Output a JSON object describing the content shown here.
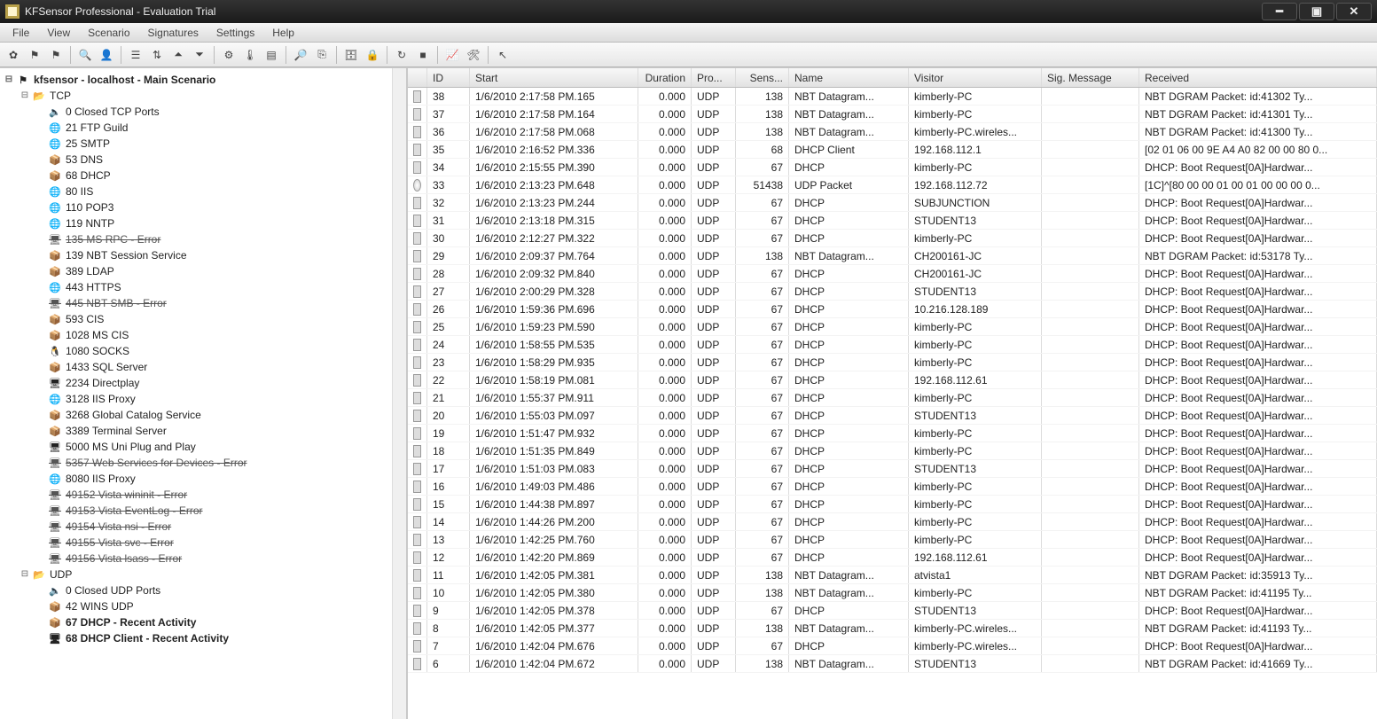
{
  "window": {
    "title": "KFSensor Professional - Evaluation Trial"
  },
  "menu": [
    "File",
    "View",
    "Scenario",
    "Signatures",
    "Settings",
    "Help"
  ],
  "tree_root": "kfsensor - localhost - Main Scenario",
  "tcp_label": "TCP",
  "udp_label": "UDP",
  "tcp_items": [
    {
      "port": "0",
      "name": "Closed TCP Ports",
      "icon": "speaker"
    },
    {
      "port": "21",
      "name": "FTP Guild",
      "icon": "globe"
    },
    {
      "port": "25",
      "name": "SMTP",
      "icon": "globe"
    },
    {
      "port": "53",
      "name": "DNS",
      "icon": "box"
    },
    {
      "port": "68",
      "name": "DHCP",
      "icon": "box"
    },
    {
      "port": "80",
      "name": "IIS",
      "icon": "globe"
    },
    {
      "port": "110",
      "name": "POP3",
      "icon": "globe"
    },
    {
      "port": "119",
      "name": "NNTP",
      "icon": "globe"
    },
    {
      "port": "135",
      "name": "MS RPC  - Error",
      "icon": "err",
      "strike": true
    },
    {
      "port": "139",
      "name": "NBT Session Service",
      "icon": "box"
    },
    {
      "port": "389",
      "name": "LDAP",
      "icon": "box"
    },
    {
      "port": "443",
      "name": "HTTPS",
      "icon": "globe"
    },
    {
      "port": "445",
      "name": "NBT SMB  - Error",
      "icon": "err",
      "strike": true
    },
    {
      "port": "593",
      "name": "CIS",
      "icon": "box"
    },
    {
      "port": "1028",
      "name": "MS CIS",
      "icon": "box"
    },
    {
      "port": "1080",
      "name": "SOCKS",
      "icon": "penguin"
    },
    {
      "port": "1433",
      "name": "SQL Server",
      "icon": "box"
    },
    {
      "port": "2234",
      "name": "Directplay",
      "icon": "pc"
    },
    {
      "port": "3128",
      "name": "IIS Proxy",
      "icon": "globe"
    },
    {
      "port": "3268",
      "name": "Global Catalog Service",
      "icon": "box"
    },
    {
      "port": "3389",
      "name": "Terminal Server",
      "icon": "box"
    },
    {
      "port": "5000",
      "name": "MS Uni Plug and Play",
      "icon": "pc"
    },
    {
      "port": "5357",
      "name": "Web Services for Devices  - Error",
      "icon": "err",
      "strike": true
    },
    {
      "port": "8080",
      "name": "IIS Proxy",
      "icon": "globe"
    },
    {
      "port": "49152",
      "name": "Vista wininit  - Error",
      "icon": "err",
      "strike": true
    },
    {
      "port": "49153",
      "name": "Vista EventLog  - Error",
      "icon": "err",
      "strike": true
    },
    {
      "port": "49154",
      "name": "Vista nsi  - Error",
      "icon": "err",
      "strike": true
    },
    {
      "port": "49155",
      "name": "Vista svc  - Error",
      "icon": "err",
      "strike": true
    },
    {
      "port": "49156",
      "name": "Vista lsass  - Error",
      "icon": "err",
      "strike": true
    }
  ],
  "udp_items": [
    {
      "port": "0",
      "name": "Closed UDP Ports",
      "icon": "speaker"
    },
    {
      "port": "42",
      "name": "WINS UDP",
      "icon": "box"
    },
    {
      "port": "67",
      "name": "DHCP  - Recent Activity",
      "icon": "box",
      "bold": true
    },
    {
      "port": "68",
      "name": "DHCP Client  - Recent Activity",
      "icon": "pc",
      "bold": true
    }
  ],
  "columns": {
    "id": "ID",
    "start": "Start",
    "duration": "Duration",
    "pro": "Pro...",
    "sens": "Sens...",
    "name": "Name",
    "visitor": "Visitor",
    "sig": "Sig. Message",
    "received": "Received"
  },
  "events": [
    {
      "id": "38",
      "start": "1/6/2010 2:17:58 PM.165",
      "dur": "0.000",
      "pro": "UDP",
      "sens": "138",
      "name": "NBT Datagram...",
      "vis": "kimberly-PC",
      "recv": "NBT DGRAM Packet: id:41302  Ty...",
      "icon": "pc"
    },
    {
      "id": "37",
      "start": "1/6/2010 2:17:58 PM.164",
      "dur": "0.000",
      "pro": "UDP",
      "sens": "138",
      "name": "NBT Datagram...",
      "vis": "kimberly-PC",
      "recv": "NBT DGRAM Packet: id:41301  Ty...",
      "icon": "pc"
    },
    {
      "id": "36",
      "start": "1/6/2010 2:17:58 PM.068",
      "dur": "0.000",
      "pro": "UDP",
      "sens": "138",
      "name": "NBT Datagram...",
      "vis": "kimberly-PC.wireles...",
      "recv": "NBT DGRAM Packet: id:41300  Ty...",
      "icon": "pc"
    },
    {
      "id": "35",
      "start": "1/6/2010 2:16:52 PM.336",
      "dur": "0.000",
      "pro": "UDP",
      "sens": "68",
      "name": "DHCP Client",
      "vis": "192.168.112.1",
      "recv": "[02 01 06 00 9E A4 A0 82 00 00 80 0...",
      "icon": "pc"
    },
    {
      "id": "34",
      "start": "1/6/2010 2:15:55 PM.390",
      "dur": "0.000",
      "pro": "UDP",
      "sens": "67",
      "name": "DHCP",
      "vis": "kimberly-PC",
      "recv": "DHCP: Boot Request[0A]Hardwar...",
      "icon": "box"
    },
    {
      "id": "33",
      "start": "1/6/2010 2:13:23 PM.648",
      "dur": "0.000",
      "pro": "UDP",
      "sens": "51438",
      "name": "UDP Packet",
      "vis": "192.168.112.72",
      "recv": "[1C]^[80 00 00 01 00 01 00 00 00 0...",
      "icon": "clock"
    },
    {
      "id": "32",
      "start": "1/6/2010 2:13:23 PM.244",
      "dur": "0.000",
      "pro": "UDP",
      "sens": "67",
      "name": "DHCP",
      "vis": "SUBJUNCTION",
      "recv": "DHCP: Boot Request[0A]Hardwar...",
      "icon": "box"
    },
    {
      "id": "31",
      "start": "1/6/2010 2:13:18 PM.315",
      "dur": "0.000",
      "pro": "UDP",
      "sens": "67",
      "name": "DHCP",
      "vis": "STUDENT13",
      "recv": "DHCP: Boot Request[0A]Hardwar...",
      "icon": "box"
    },
    {
      "id": "30",
      "start": "1/6/2010 2:12:27 PM.322",
      "dur": "0.000",
      "pro": "UDP",
      "sens": "67",
      "name": "DHCP",
      "vis": "kimberly-PC",
      "recv": "DHCP: Boot Request[0A]Hardwar...",
      "icon": "box"
    },
    {
      "id": "29",
      "start": "1/6/2010 2:09:37 PM.764",
      "dur": "0.000",
      "pro": "UDP",
      "sens": "138",
      "name": "NBT Datagram...",
      "vis": "CH200161-JC",
      "recv": "NBT DGRAM Packet: id:53178  Ty...",
      "icon": "pc"
    },
    {
      "id": "28",
      "start": "1/6/2010 2:09:32 PM.840",
      "dur": "0.000",
      "pro": "UDP",
      "sens": "67",
      "name": "DHCP",
      "vis": "CH200161-JC",
      "recv": "DHCP: Boot Request[0A]Hardwar...",
      "icon": "box"
    },
    {
      "id": "27",
      "start": "1/6/2010 2:00:29 PM.328",
      "dur": "0.000",
      "pro": "UDP",
      "sens": "67",
      "name": "DHCP",
      "vis": "STUDENT13",
      "recv": "DHCP: Boot Request[0A]Hardwar...",
      "icon": "box"
    },
    {
      "id": "26",
      "start": "1/6/2010 1:59:36 PM.696",
      "dur": "0.000",
      "pro": "UDP",
      "sens": "67",
      "name": "DHCP",
      "vis": "10.216.128.189",
      "recv": "DHCP: Boot Request[0A]Hardwar...",
      "icon": "box"
    },
    {
      "id": "25",
      "start": "1/6/2010 1:59:23 PM.590",
      "dur": "0.000",
      "pro": "UDP",
      "sens": "67",
      "name": "DHCP",
      "vis": "kimberly-PC",
      "recv": "DHCP: Boot Request[0A]Hardwar...",
      "icon": "box"
    },
    {
      "id": "24",
      "start": "1/6/2010 1:58:55 PM.535",
      "dur": "0.000",
      "pro": "UDP",
      "sens": "67",
      "name": "DHCP",
      "vis": "kimberly-PC",
      "recv": "DHCP: Boot Request[0A]Hardwar...",
      "icon": "box"
    },
    {
      "id": "23",
      "start": "1/6/2010 1:58:29 PM.935",
      "dur": "0.000",
      "pro": "UDP",
      "sens": "67",
      "name": "DHCP",
      "vis": "kimberly-PC",
      "recv": "DHCP: Boot Request[0A]Hardwar...",
      "icon": "box"
    },
    {
      "id": "22",
      "start": "1/6/2010 1:58:19 PM.081",
      "dur": "0.000",
      "pro": "UDP",
      "sens": "67",
      "name": "DHCP",
      "vis": "192.168.112.61",
      "recv": "DHCP: Boot Request[0A]Hardwar...",
      "icon": "box"
    },
    {
      "id": "21",
      "start": "1/6/2010 1:55:37 PM.911",
      "dur": "0.000",
      "pro": "UDP",
      "sens": "67",
      "name": "DHCP",
      "vis": "kimberly-PC",
      "recv": "DHCP: Boot Request[0A]Hardwar...",
      "icon": "box"
    },
    {
      "id": "20",
      "start": "1/6/2010 1:55:03 PM.097",
      "dur": "0.000",
      "pro": "UDP",
      "sens": "67",
      "name": "DHCP",
      "vis": "STUDENT13",
      "recv": "DHCP: Boot Request[0A]Hardwar...",
      "icon": "box"
    },
    {
      "id": "19",
      "start": "1/6/2010 1:51:47 PM.932",
      "dur": "0.000",
      "pro": "UDP",
      "sens": "67",
      "name": "DHCP",
      "vis": "kimberly-PC",
      "recv": "DHCP: Boot Request[0A]Hardwar...",
      "icon": "box"
    },
    {
      "id": "18",
      "start": "1/6/2010 1:51:35 PM.849",
      "dur": "0.000",
      "pro": "UDP",
      "sens": "67",
      "name": "DHCP",
      "vis": "kimberly-PC",
      "recv": "DHCP: Boot Request[0A]Hardwar...",
      "icon": "box"
    },
    {
      "id": "17",
      "start": "1/6/2010 1:51:03 PM.083",
      "dur": "0.000",
      "pro": "UDP",
      "sens": "67",
      "name": "DHCP",
      "vis": "STUDENT13",
      "recv": "DHCP: Boot Request[0A]Hardwar...",
      "icon": "box"
    },
    {
      "id": "16",
      "start": "1/6/2010 1:49:03 PM.486",
      "dur": "0.000",
      "pro": "UDP",
      "sens": "67",
      "name": "DHCP",
      "vis": "kimberly-PC",
      "recv": "DHCP: Boot Request[0A]Hardwar...",
      "icon": "box"
    },
    {
      "id": "15",
      "start": "1/6/2010 1:44:38 PM.897",
      "dur": "0.000",
      "pro": "UDP",
      "sens": "67",
      "name": "DHCP",
      "vis": "kimberly-PC",
      "recv": "DHCP: Boot Request[0A]Hardwar...",
      "icon": "box"
    },
    {
      "id": "14",
      "start": "1/6/2010 1:44:26 PM.200",
      "dur": "0.000",
      "pro": "UDP",
      "sens": "67",
      "name": "DHCP",
      "vis": "kimberly-PC",
      "recv": "DHCP: Boot Request[0A]Hardwar...",
      "icon": "box"
    },
    {
      "id": "13",
      "start": "1/6/2010 1:42:25 PM.760",
      "dur": "0.000",
      "pro": "UDP",
      "sens": "67",
      "name": "DHCP",
      "vis": "kimberly-PC",
      "recv": "DHCP: Boot Request[0A]Hardwar...",
      "icon": "box"
    },
    {
      "id": "12",
      "start": "1/6/2010 1:42:20 PM.869",
      "dur": "0.000",
      "pro": "UDP",
      "sens": "67",
      "name": "DHCP",
      "vis": "192.168.112.61",
      "recv": "DHCP: Boot Request[0A]Hardwar...",
      "icon": "box"
    },
    {
      "id": "11",
      "start": "1/6/2010 1:42:05 PM.381",
      "dur": "0.000",
      "pro": "UDP",
      "sens": "138",
      "name": "NBT Datagram...",
      "vis": "atvista1",
      "recv": "NBT DGRAM Packet: id:35913  Ty...",
      "icon": "pc"
    },
    {
      "id": "10",
      "start": "1/6/2010 1:42:05 PM.380",
      "dur": "0.000",
      "pro": "UDP",
      "sens": "138",
      "name": "NBT Datagram...",
      "vis": "kimberly-PC",
      "recv": "NBT DGRAM Packet: id:41195  Ty...",
      "icon": "pc"
    },
    {
      "id": "9",
      "start": "1/6/2010 1:42:05 PM.378",
      "dur": "0.000",
      "pro": "UDP",
      "sens": "67",
      "name": "DHCP",
      "vis": "STUDENT13",
      "recv": "DHCP: Boot Request[0A]Hardwar...",
      "icon": "box"
    },
    {
      "id": "8",
      "start": "1/6/2010 1:42:05 PM.377",
      "dur": "0.000",
      "pro": "UDP",
      "sens": "138",
      "name": "NBT Datagram...",
      "vis": "kimberly-PC.wireles...",
      "recv": "NBT DGRAM Packet: id:41193  Ty...",
      "icon": "pc"
    },
    {
      "id": "7",
      "start": "1/6/2010 1:42:04 PM.676",
      "dur": "0.000",
      "pro": "UDP",
      "sens": "67",
      "name": "DHCP",
      "vis": "kimberly-PC.wireles...",
      "recv": "DHCP: Boot Request[0A]Hardwar...",
      "icon": "box"
    },
    {
      "id": "6",
      "start": "1/6/2010 1:42:04 PM.672",
      "dur": "0.000",
      "pro": "UDP",
      "sens": "138",
      "name": "NBT Datagram...",
      "vis": "STUDENT13",
      "recv": "NBT DGRAM Packet: id:41669  Ty...",
      "icon": "pc"
    }
  ]
}
